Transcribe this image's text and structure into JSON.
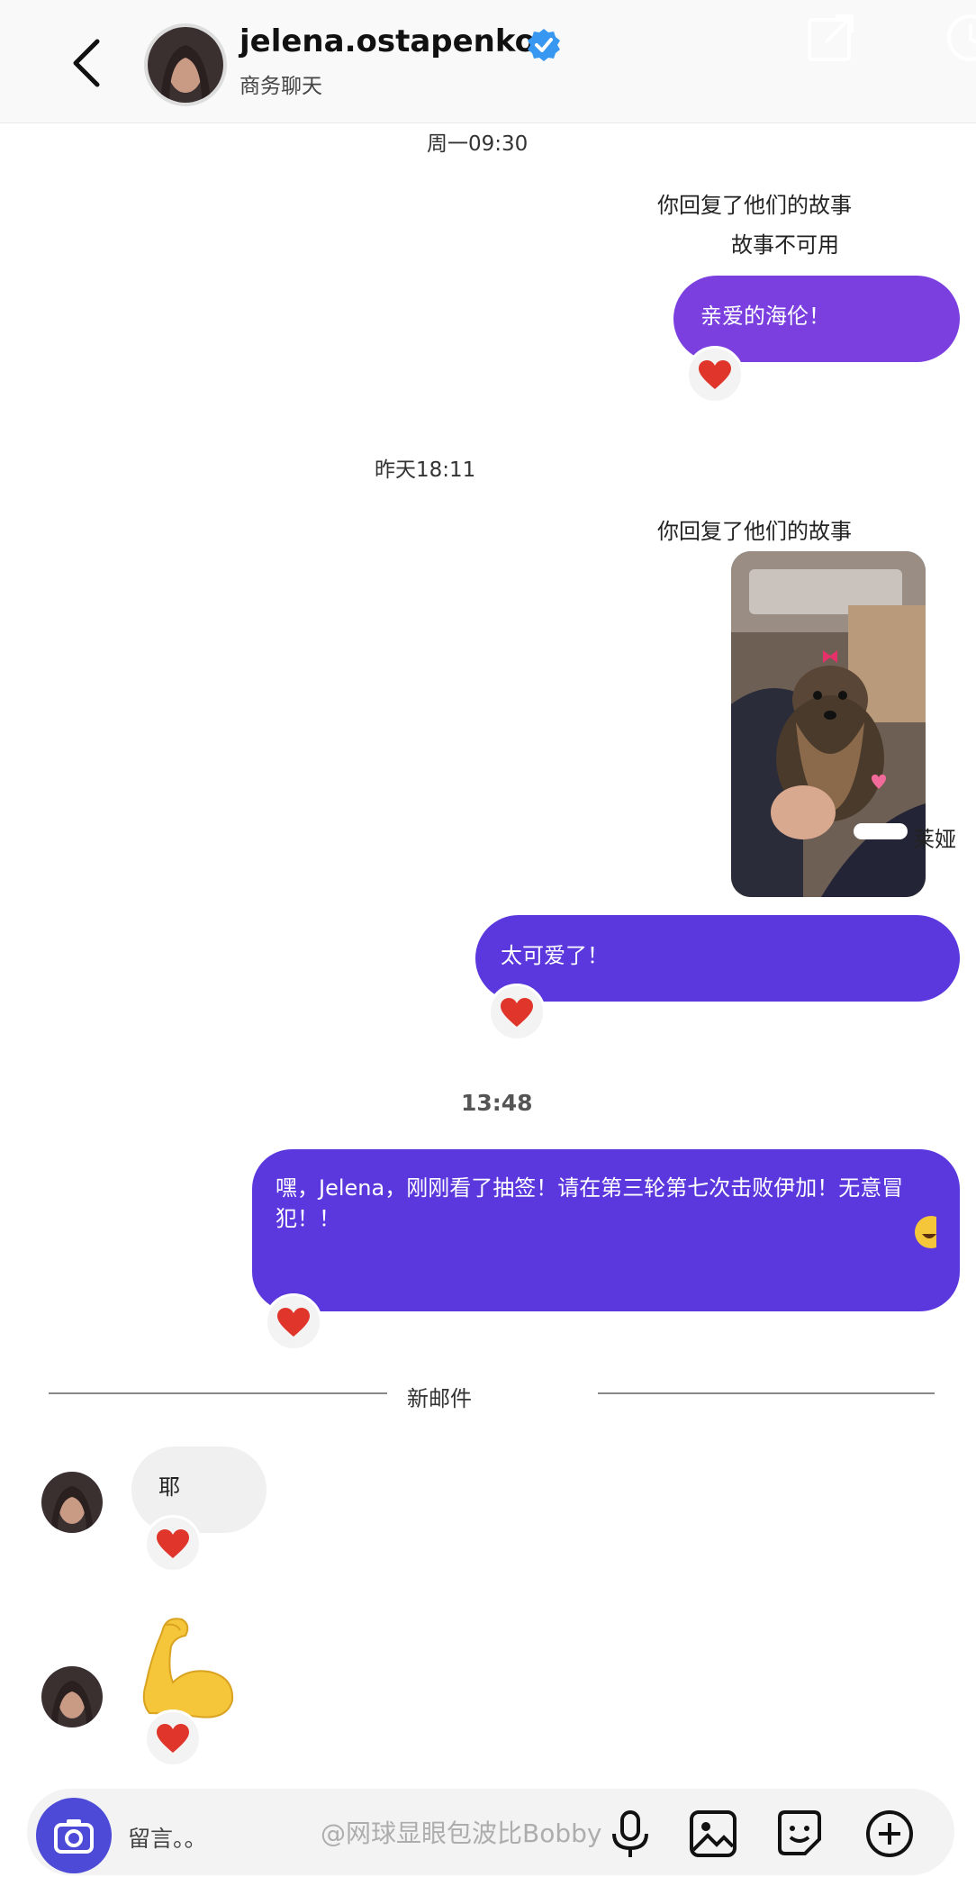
{
  "header": {
    "username": "jelena.ostapenko",
    "subtitle": "商务聊天"
  },
  "messages": {
    "ts1": "周一09:30",
    "story_reply_1": "你回复了他们的故事",
    "story_unavailable": "故事不可用",
    "bubble_1": "亲爱的海伦！",
    "ts2": "昨天18:11",
    "story_reply_2": "你回复了他们的故事",
    "story_caption": "莱娅",
    "bubble_2": "太可爱了！",
    "ts3": "13:48",
    "bubble_3": "嘿，Jelena，刚刚看了抽签！请在第三轮第七次击败伊加！无意冒犯！！",
    "new_mail": "新邮件",
    "incoming_1": "耶"
  },
  "composer": {
    "placeholder": "留言。。"
  },
  "watermark": "@网球显眼包波比Bobby",
  "colors": {
    "bubble_purple": "#7b3fe0",
    "bubble_indigo": "#5b37de",
    "camera_blue": "#4d4ad8",
    "heart_red": "#e0352b",
    "verified_blue": "#3897f0"
  },
  "icons": [
    "back-icon",
    "verified-icon",
    "share-icon",
    "heart-icon",
    "muscle-emoji-icon",
    "camera-icon",
    "microphone-icon",
    "image-icon",
    "sticker-icon",
    "plus-icon"
  ]
}
